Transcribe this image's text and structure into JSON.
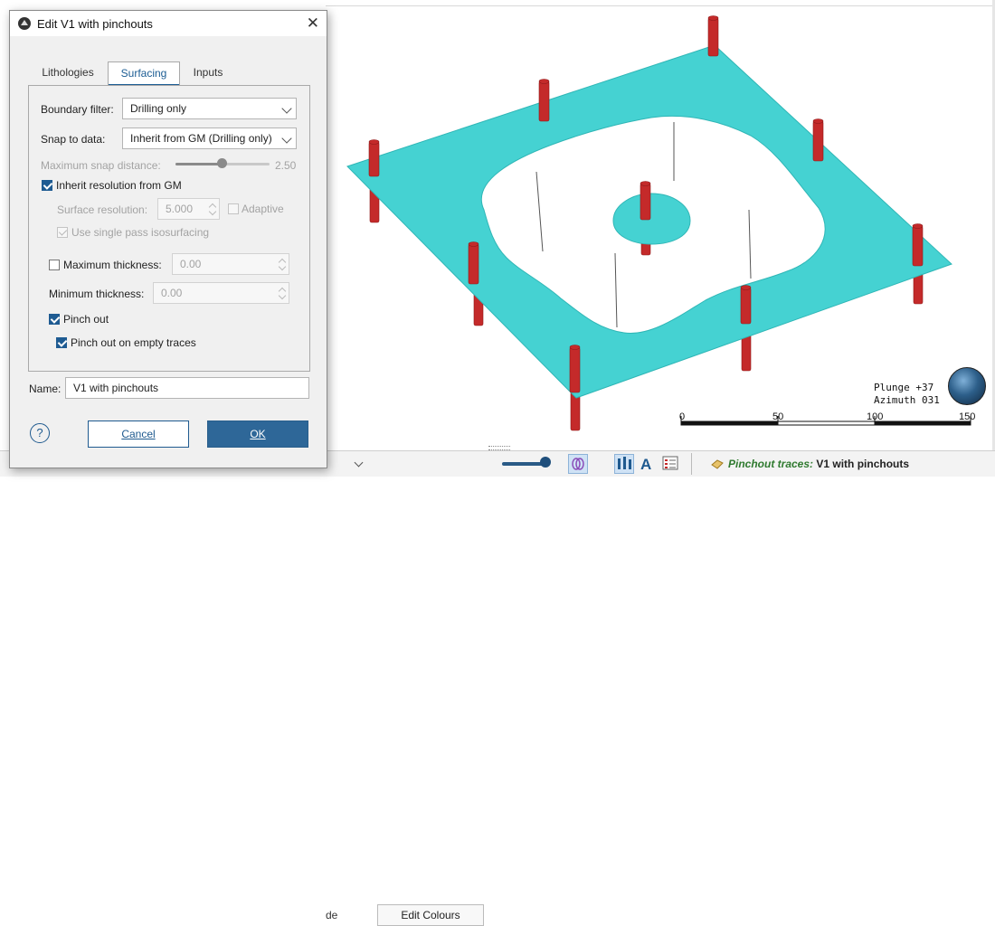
{
  "dialog": {
    "title": "Edit V1 with pinchouts",
    "close_label": "✕",
    "tabs": [
      {
        "label": "Lithologies",
        "active": false
      },
      {
        "label": "Surfacing",
        "active": true
      },
      {
        "label": "Inputs",
        "active": false
      }
    ],
    "boundary_filter": {
      "label": "Boundary filter:",
      "value": "Drilling only"
    },
    "snap_to_data": {
      "label": "Snap to data:",
      "value": "Inherit from GM (Drilling only)"
    },
    "max_snap_distance": {
      "label": "Maximum snap distance:",
      "value": "2.50",
      "slider_fraction": 0.5
    },
    "inherit_resolution": {
      "label": "Inherit resolution from GM",
      "checked": true
    },
    "surface_resolution": {
      "label": "Surface resolution:",
      "value": "5.000"
    },
    "adaptive": {
      "label": "Adaptive",
      "checked": false
    },
    "single_pass": {
      "label": "Use single pass isosurfacing",
      "checked": true
    },
    "maximum_thickness": {
      "label": "Maximum thickness:",
      "value": "0.00",
      "checked": false
    },
    "minimum_thickness": {
      "label": "Minimum thickness:",
      "value": "0.00"
    },
    "pinch_out": {
      "label": "Pinch out",
      "checked": true
    },
    "pinch_out_empty": {
      "label": "Pinch out on empty traces",
      "checked": true
    },
    "name": {
      "label": "Name:",
      "value": "V1 with pinchouts"
    },
    "help_label": "?",
    "cancel_label": "Cancel",
    "ok_label": "OK"
  },
  "viewport": {
    "plunge": "Plunge +37",
    "azimuth": "Azimuth 031",
    "scale_labels": [
      "0",
      "50",
      "100",
      "150"
    ],
    "surface_color": "#45d2d2",
    "drillhole_color": "#c42a2a"
  },
  "bottom_bar": {
    "fragment_text": "de",
    "edit_colours_label": "Edit Colours",
    "status_key": "Pinchout traces:",
    "status_value": "V1 with pinchouts"
  }
}
